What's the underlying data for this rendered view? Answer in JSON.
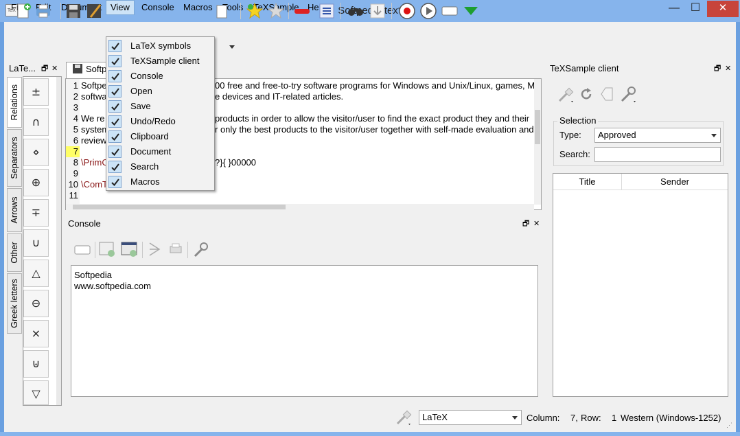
{
  "window": {
    "title": "Softpedia.tex*",
    "app_icon_text": "TeX",
    "minimize": "—",
    "maximize": "☐",
    "close": "✕"
  },
  "menubar": [
    "File",
    "Edit",
    "Document",
    "View",
    "Console",
    "Macros",
    "Tools",
    "TeXSample",
    "Help"
  ],
  "view_menu": {
    "items": [
      {
        "label": "LaTeX symbols",
        "checked": true
      },
      {
        "label": "TeXSample client",
        "checked": true
      },
      {
        "label": "Console",
        "checked": true
      },
      {
        "label": "Open",
        "checked": true
      },
      {
        "label": "Save",
        "checked": true
      },
      {
        "label": "Undo/Redo",
        "checked": true
      },
      {
        "label": "Clipboard",
        "checked": true
      },
      {
        "label": "Document",
        "checked": true
      },
      {
        "label": "Search",
        "checked": true
      },
      {
        "label": "Macros",
        "checked": true
      }
    ]
  },
  "latex_panel": {
    "title": "LaTe...",
    "tabs": [
      "Relations",
      "Separators",
      "Arrows",
      "Other",
      "Greek letters"
    ],
    "symbols": [
      "±",
      "∩",
      "⋄",
      "⊕",
      "∓",
      "∪",
      "△",
      "⊖",
      "×",
      "⊎",
      "▽"
    ]
  },
  "editor": {
    "tab_label": "Softp",
    "line_numbers": [
      "1",
      "2",
      "3",
      "4",
      "5",
      "6",
      "7",
      "8",
      "9",
      "10",
      "11"
    ],
    "fragments": {
      "l1a": "Softpe",
      "l1b": "00 free and free-to-try software programs for Windows and Unix/Linux, games, Ma",
      "l2a": "softwa",
      "l2b": "e devices and IT-related articles.",
      "l4a": "We re",
      "l4b": "products in order to allow the visitor/user to find the exact product they and their",
      "l5a": "system",
      "l5b": "r only the best products to the visitor/user together with self-made evaluation and",
      "l6a": "review",
      "l8a": "\\PrimC",
      "l8b": "?}{ }00000",
      "l10a": "\\ComT"
    }
  },
  "console_panel": {
    "title": "Console",
    "output": [
      "Softpedia",
      "www.softpedia.com"
    ]
  },
  "texsample_panel": {
    "title": "TeXSample client",
    "selection_label": "Selection",
    "type_label": "Type:",
    "type_value": "Approved",
    "search_label": "Search:",
    "search_value": "",
    "columns": [
      "Title",
      "Sender"
    ]
  },
  "statusbar": {
    "mode": "LaTeX",
    "column_label": "Column:",
    "column_value": "7,",
    "row_label": "Row:",
    "row_value": "1",
    "encoding": "Western (Windows-1252)"
  },
  "colors": {
    "title_bar": "#86b4ec",
    "close_button": "#c7443b",
    "menu_highlight": "#cde3f7",
    "current_line_marker": "#ffff66"
  }
}
